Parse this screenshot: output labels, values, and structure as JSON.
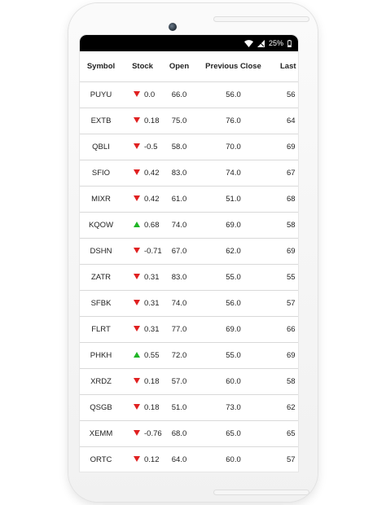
{
  "status_bar": {
    "battery_text": "25%",
    "icons": [
      "wifi-icon",
      "signal-icon",
      "battery-icon"
    ]
  },
  "colors": {
    "down": "#e02020",
    "up": "#1fb525",
    "status_bar_bg": "#000000"
  },
  "table": {
    "headers": {
      "symbol": "Symbol",
      "stock": "Stock",
      "open": "Open",
      "previous_close": "Previous Close",
      "last_trade": "Last Tra"
    },
    "rows": [
      {
        "symbol": "PUYU",
        "direction": "down",
        "stock": "0.0",
        "open": "66.0",
        "previous_close": "56.0",
        "last_trade": "56"
      },
      {
        "symbol": "EXTB",
        "direction": "down",
        "stock": "0.18",
        "open": "75.0",
        "previous_close": "76.0",
        "last_trade": "64"
      },
      {
        "symbol": "QBLI",
        "direction": "down",
        "stock": "-0.5",
        "open": "58.0",
        "previous_close": "70.0",
        "last_trade": "69"
      },
      {
        "symbol": "SFIO",
        "direction": "down",
        "stock": "0.42",
        "open": "83.0",
        "previous_close": "74.0",
        "last_trade": "67"
      },
      {
        "symbol": "MIXR",
        "direction": "down",
        "stock": "0.42",
        "open": "61.0",
        "previous_close": "51.0",
        "last_trade": "68"
      },
      {
        "symbol": "KQOW",
        "direction": "up",
        "stock": "0.68",
        "open": "74.0",
        "previous_close": "69.0",
        "last_trade": "58"
      },
      {
        "symbol": "DSHN",
        "direction": "down",
        "stock": "-0.71",
        "open": "67.0",
        "previous_close": "62.0",
        "last_trade": "69"
      },
      {
        "symbol": "ZATR",
        "direction": "down",
        "stock": "0.31",
        "open": "83.0",
        "previous_close": "55.0",
        "last_trade": "55"
      },
      {
        "symbol": "SFBK",
        "direction": "down",
        "stock": "0.31",
        "open": "74.0",
        "previous_close": "56.0",
        "last_trade": "57"
      },
      {
        "symbol": "FLRT",
        "direction": "down",
        "stock": "0.31",
        "open": "77.0",
        "previous_close": "69.0",
        "last_trade": "66"
      },
      {
        "symbol": "PHKH",
        "direction": "up",
        "stock": "0.55",
        "open": "72.0",
        "previous_close": "55.0",
        "last_trade": "69"
      },
      {
        "symbol": "XRDZ",
        "direction": "down",
        "stock": "0.18",
        "open": "57.0",
        "previous_close": "60.0",
        "last_trade": "58"
      },
      {
        "symbol": "QSGB",
        "direction": "down",
        "stock": "0.18",
        "open": "51.0",
        "previous_close": "73.0",
        "last_trade": "62"
      },
      {
        "symbol": "XEMM",
        "direction": "down",
        "stock": "-0.76",
        "open": "68.0",
        "previous_close": "65.0",
        "last_trade": "65"
      },
      {
        "symbol": "ORTC",
        "direction": "down",
        "stock": "0.12",
        "open": "64.0",
        "previous_close": "60.0",
        "last_trade": "57"
      }
    ]
  }
}
